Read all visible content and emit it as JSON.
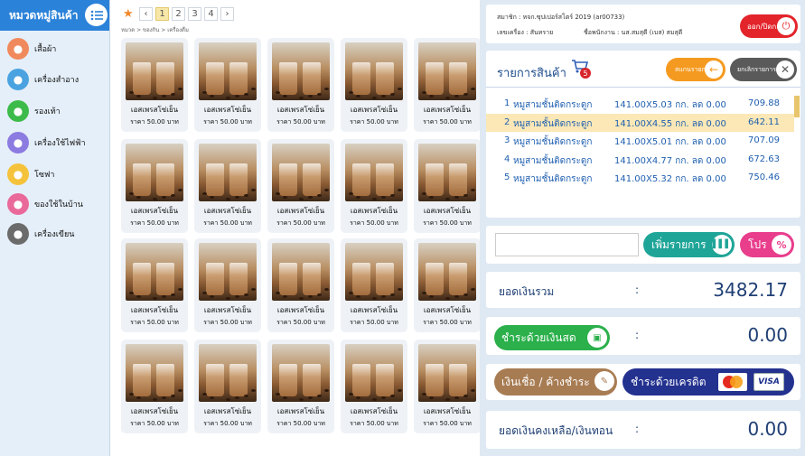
{
  "sidebar": {
    "title": "หมวดหมู่สินค้า",
    "items": [
      {
        "label": "เสื้อผ้า",
        "icon": "shirt-icon",
        "color": "#f08a5d"
      },
      {
        "label": "เครื่องสำอาง",
        "icon": "cosmetics-icon",
        "color": "#4aa3e0"
      },
      {
        "label": "รองเท้า",
        "icon": "shoe-icon",
        "color": "#3dbb4a"
      },
      {
        "label": "เครื่องใช้ไฟฟ้า",
        "icon": "appliance-icon",
        "color": "#8c7be0"
      },
      {
        "label": "โซฟา",
        "icon": "sofa-icon",
        "color": "#f5c33b"
      },
      {
        "label": "ของใช้ในบ้าน",
        "icon": "home-icon",
        "color": "#e96a9a"
      },
      {
        "label": "เครื่องเขียน",
        "icon": "stationery-icon",
        "color": "#6b6b6b"
      }
    ]
  },
  "pager": {
    "pages": [
      "1",
      "2",
      "3",
      "4"
    ],
    "active": "1"
  },
  "breadcrumb": "หมวด > ของกิน > เครื่องดื่ม",
  "products": {
    "name": "เอสเพรสโซ่เย็น",
    "price": "ราคา 50.00 บาท"
  },
  "info": {
    "member": "สมาชิก : หจก.ซุปเปอร์สโตร์ 2019 (ar00733)",
    "terminal": "เลขเครื่อง : สันทราย",
    "employee": "ชื่อพนักงาน : นส.สมสุดี (เบส) สมสุดี",
    "logout": "ออก/ปิดกะ"
  },
  "items": {
    "title": "รายการสินค้า",
    "count": "5",
    "add_label": "สแกนรายการ",
    "cancel_label": "ยกเลิกรายการ",
    "rows": [
      {
        "no": "1",
        "name": "หมูสามชั้นติดกระดูก",
        "qty": "141.00X5.03 กก. ลด 0.00",
        "total": "709.88"
      },
      {
        "no": "2",
        "name": "หมูสามชั้นติดกระดูก",
        "qty": "141.00X4.55 กก. ลด 0.00",
        "total": "642.11"
      },
      {
        "no": "3",
        "name": "หมูสามชั้นติดกระดูก",
        "qty": "141.00X5.01 กก. ลด 0.00",
        "total": "707.09"
      },
      {
        "no": "4",
        "name": "หมูสามชั้นติดกระดูก",
        "qty": "141.00X4.77 กก. ลด 0.00",
        "total": "672.63"
      },
      {
        "no": "5",
        "name": "หมูสามชั้นติดกระดูก",
        "qty": "141.00X5.32 กก. ลด 0.00",
        "total": "750.46"
      }
    ],
    "selected_index": 1
  },
  "scan": {
    "add_list": "เพิ่มรายการ",
    "promo": "โปร"
  },
  "totals": {
    "sum_label": "ยอดเงินรวม",
    "sum_value": "3482.17",
    "cash_label": "ชำระด้วยเงินสด",
    "cash_value": "0.00",
    "credit_label": "เงินเชื่อ / ค้างชำระ",
    "card_label": "ชำระด้วยเครดิต",
    "visa": "VISA",
    "balance_label": "ยอดเงินคงเหลือ/เงินทอน",
    "balance_value": "0.00",
    "colon": ":"
  }
}
